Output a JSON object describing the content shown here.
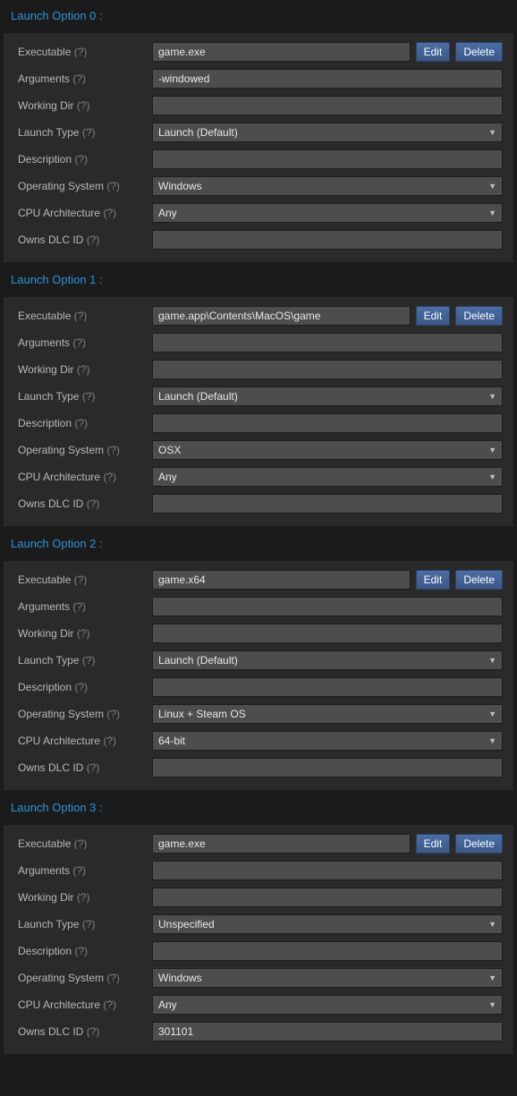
{
  "buttons": {
    "edit": "Edit",
    "delete": "Delete"
  },
  "labels": {
    "executable": "Executable",
    "arguments": "Arguments",
    "working_dir": "Working Dir",
    "launch_type": "Launch Type",
    "description": "Description",
    "operating_system": "Operating System",
    "cpu_arch": "CPU Architecture",
    "owns_dlc_id": "Owns DLC ID",
    "hint": "(?)"
  },
  "options": [
    {
      "title": "Launch Option 0 :",
      "executable": "game.exe",
      "arguments": "-windowed",
      "working_dir": "",
      "launch_type": "Launch (Default)",
      "description": "",
      "operating_system": "Windows",
      "cpu_arch": "Any",
      "owns_dlc_id": ""
    },
    {
      "title": "Launch Option 1 :",
      "executable": "game.app\\Contents\\MacOS\\game",
      "arguments": "",
      "working_dir": "",
      "launch_type": "Launch (Default)",
      "description": "",
      "operating_system": "OSX",
      "cpu_arch": "Any",
      "owns_dlc_id": ""
    },
    {
      "title": "Launch Option 2 :",
      "executable": "game.x64",
      "arguments": "",
      "working_dir": "",
      "launch_type": "Launch (Default)",
      "description": "",
      "operating_system": "Linux + Steam OS",
      "cpu_arch": "64-bit",
      "owns_dlc_id": ""
    },
    {
      "title": "Launch Option 3 :",
      "executable": "game.exe",
      "arguments": "",
      "working_dir": "",
      "launch_type": "Unspecified",
      "description": "",
      "operating_system": "Windows",
      "cpu_arch": "Any",
      "owns_dlc_id": "301101"
    }
  ]
}
